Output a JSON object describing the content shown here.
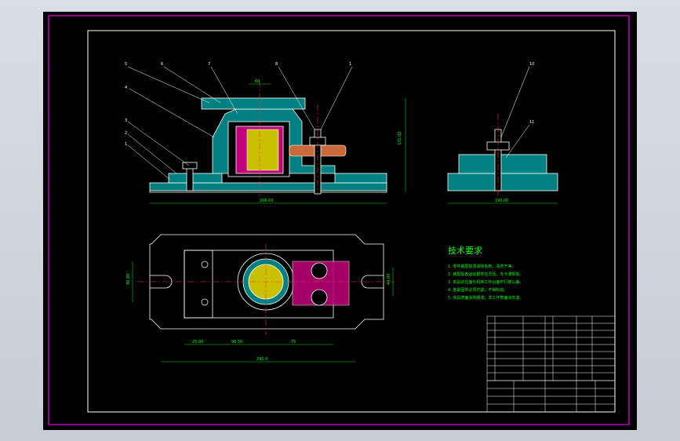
{
  "title_text": "技术要求",
  "requirements": [
    "1. 零件装配前须清除毛刺，清洗干净。",
    "2. 装配后各运动部件应灵活，无卡滞现象。",
    "3. 夹具定位面与机床工作台面平行度公差。",
    "4. 各紧固件必须拧紧，不得松动。",
    "5. 夹具表面涂防锈漆，非工作表面涂灰漆。"
  ],
  "dimensions": {
    "top_width": "60",
    "length_main": "206.00",
    "height_main": "131.00",
    "side_length": "190.00",
    "plan_length": "290.0",
    "plan_a": "25.00",
    "plan_b": "96.50",
    "plan_c": "75",
    "plan_height": "90.00",
    "plan_right": "44.00",
    "section_small": "20",
    "side_ref": "6"
  },
  "balloons": [
    "5",
    "6",
    "7",
    "8",
    "1",
    "4",
    "3",
    "2",
    "1",
    "10",
    "11"
  ],
  "colors": {
    "frame": "#c000c0",
    "outline": "#ffffff",
    "hatch": "#00a0a0",
    "part_fill": "#008080",
    "workpiece": "#c8c000",
    "centerline": "#ff3030",
    "dimension": "#00d000",
    "text": "#00ff00"
  }
}
